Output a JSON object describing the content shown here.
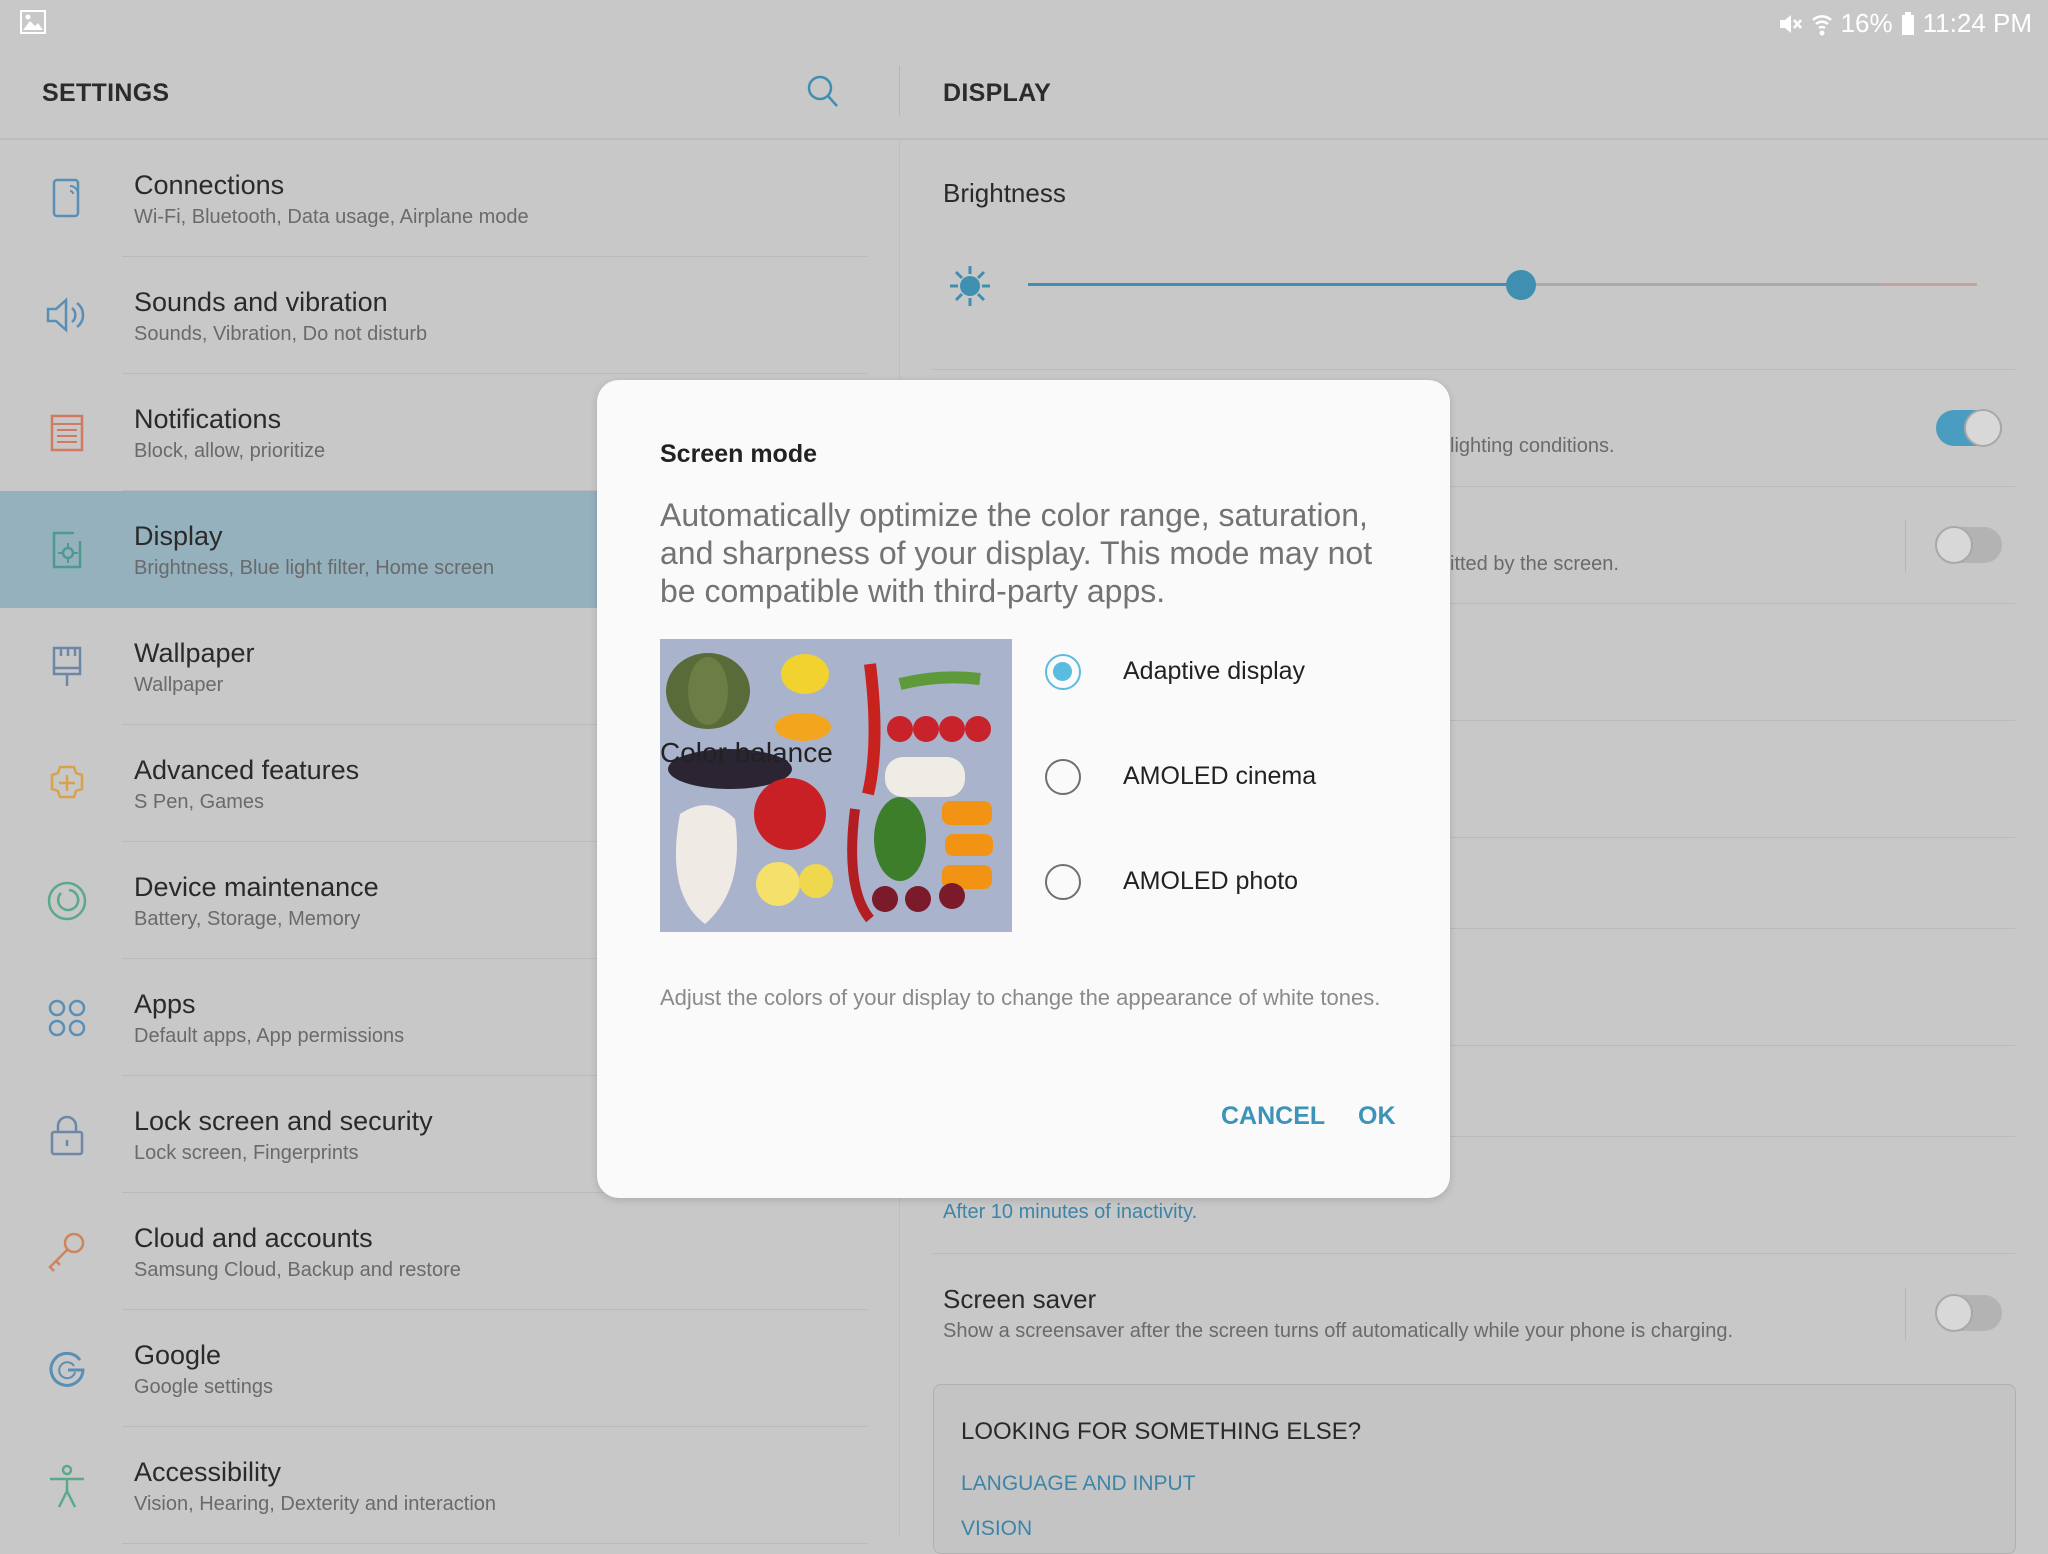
{
  "status_bar": {
    "battery": "16%",
    "time": "11:24 PM",
    "icons": [
      "image-icon",
      "mute-icon",
      "wifi-icon",
      "battery-icon"
    ]
  },
  "header": {
    "left_title": "SETTINGS",
    "right_title": "DISPLAY",
    "search_icon": "search-icon"
  },
  "sidebar": {
    "selected": "Display",
    "items": [
      {
        "title": "Connections",
        "subtitle": "Wi-Fi, Bluetooth, Data usage, Airplane mode",
        "icon": "connections-icon",
        "color": "#5a8fb5"
      },
      {
        "title": "Sounds and vibration",
        "subtitle": "Sounds, Vibration, Do not disturb",
        "icon": "speaker-icon",
        "color": "#5a8fb5"
      },
      {
        "title": "Notifications",
        "subtitle": "Block, allow, prioritize",
        "icon": "notifications-icon",
        "color": "#d07a63"
      },
      {
        "title": "Display",
        "subtitle": "Brightness, Blue light filter, Home screen",
        "icon": "display-icon",
        "color": "#4f9a8f"
      },
      {
        "title": "Wallpaper",
        "subtitle": "Wallpaper",
        "icon": "wallpaper-brush-icon",
        "color": "#6d87a6"
      },
      {
        "title": "Advanced features",
        "subtitle": "S Pen, Games",
        "icon": "puzzle-gear-icon",
        "color": "#d8a24c"
      },
      {
        "title": "Device maintenance",
        "subtitle": "Battery, Storage, Memory",
        "icon": "maintenance-icon",
        "color": "#5aa98a"
      },
      {
        "title": "Apps",
        "subtitle": "Default apps, App permissions",
        "icon": "apps-icon",
        "color": "#5a8fb5"
      },
      {
        "title": "Lock screen and security",
        "subtitle": "Lock screen, Fingerprints",
        "icon": "lock-icon",
        "color": "#6d87a6"
      },
      {
        "title": "Cloud and accounts",
        "subtitle": "Samsung Cloud, Backup and restore",
        "icon": "key-icon",
        "color": "#d0845a"
      },
      {
        "title": "Google",
        "subtitle": "Google settings",
        "icon": "google-icon",
        "color": "#5a8fb5"
      },
      {
        "title": "Accessibility",
        "subtitle": "Vision, Hearing, Dexterity and interaction",
        "icon": "accessibility-icon",
        "color": "#5aa98a"
      }
    ]
  },
  "display": {
    "brightness_label": "Brightness",
    "brightness_fraction": 0.52,
    "auto_brightness_fragment": "lighting conditions.",
    "auto_brightness_on": true,
    "blue_light_fragment": "itted by the screen.",
    "blue_light_on": false,
    "screen_timeout_value": "After 10 minutes of inactivity.",
    "screen_saver": {
      "title": "Screen saver",
      "subtitle": "Show a screensaver after the screen turns off automatically while your phone is charging.",
      "on": false
    },
    "looking": {
      "title": "LOOKING FOR SOMETHING ELSE?",
      "links": [
        "LANGUAGE AND INPUT",
        "VISION"
      ]
    }
  },
  "dialog": {
    "title": "Screen mode",
    "description": "Automatically optimize the color range, saturation, and sharpness of your display. This mode may not be compatible with third-party apps.",
    "options": [
      {
        "label": "Adaptive display",
        "selected": true
      },
      {
        "label": "AMOLED cinema",
        "selected": false
      },
      {
        "label": "AMOLED photo",
        "selected": false
      }
    ],
    "color_balance_title": "Color balance",
    "color_balance_subtitle": "Adjust the colors of your display to change the appearance of white tones.",
    "cancel": "CANCEL",
    "ok": "OK"
  },
  "colors": {
    "accent": "#3d93b8",
    "radio": "#5bbbe0",
    "toggle_on": "#4a9cc0"
  }
}
